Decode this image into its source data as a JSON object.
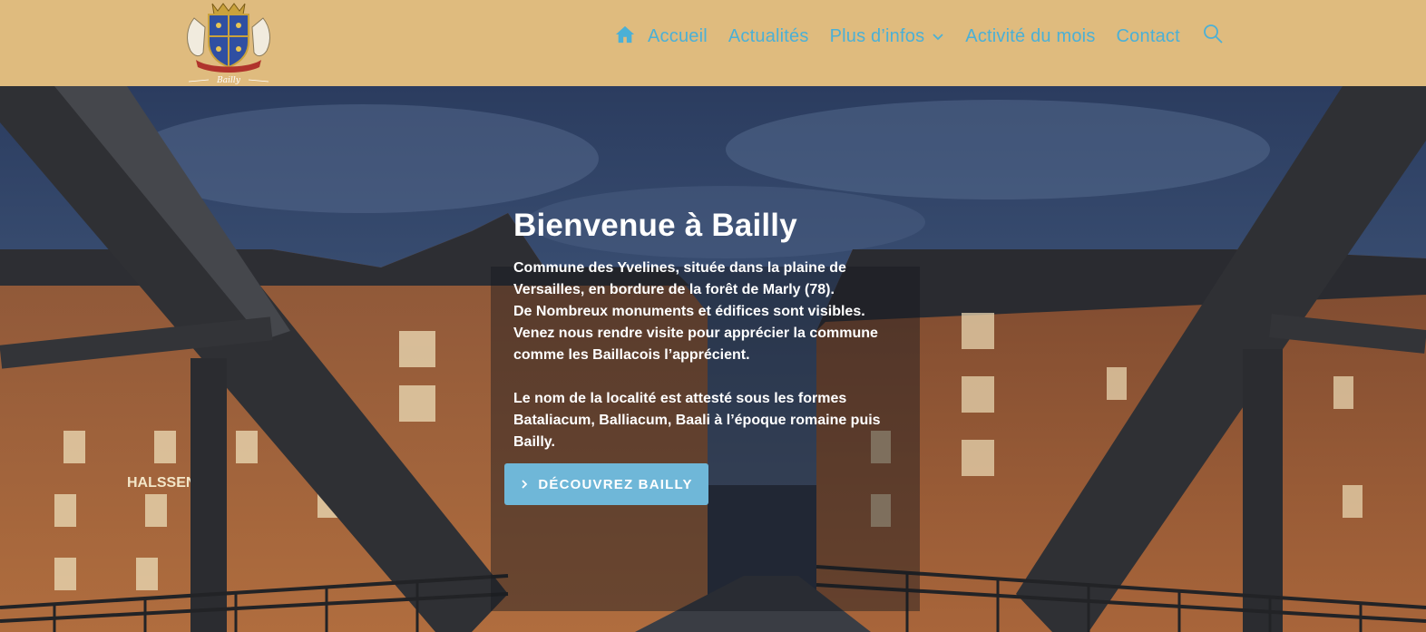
{
  "header": {
    "logo_text": "Bailly",
    "bg_color": "#dfbb7e",
    "link_color": "#4bb0d6"
  },
  "nav": {
    "items": [
      {
        "label": "Accueil",
        "icon": "home-icon"
      },
      {
        "label": "Actualités"
      },
      {
        "label": "Plus d’infos",
        "icon": "chevron-down-icon"
      },
      {
        "label": "Activité du mois"
      },
      {
        "label": "Contact"
      }
    ],
    "search_icon": "search-icon"
  },
  "hero": {
    "title": "Bienvenue à Bailly",
    "paragraph1": [
      "Commune des Yvelines, située dans la plaine de",
      "Versailles, en bordure de la forêt de Marly (78).",
      "De Nombreux monuments et édifices sont visibles.",
      "Venez nous rendre visite pour apprécier la commune",
      "comme les Baillacois l’apprécient."
    ],
    "paragraph2": [
      "Le nom de la localité est attesté sous les formes",
      "Bataliacum, Balliacum, Baali à l’époque romaine puis",
      "Bailly."
    ],
    "cta_label": "DÉCOUVREZ BAILLY",
    "cta_color": "#6fb7d8",
    "sign_text": "HALSSEN    YO"
  }
}
